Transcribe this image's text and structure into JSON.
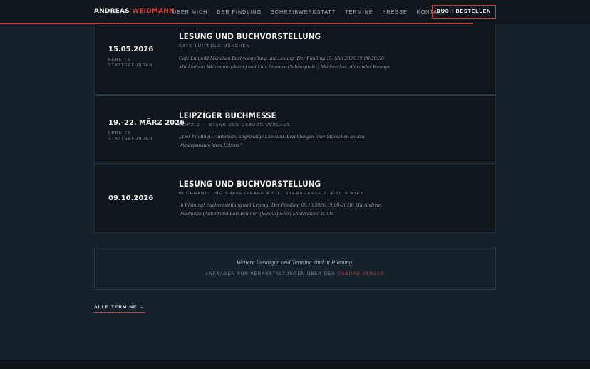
{
  "header": {
    "logo_first": "ANDREAS ",
    "logo_second": "WEIDMANN",
    "nav": [
      "ÜBER MICH",
      "DER FINDLING",
      "SCHREIBWERKSTATT",
      "TERMINE",
      "PRESSE",
      "KONTAKT"
    ],
    "order_button": "BUCH BESTELLEN"
  },
  "events": [
    {
      "date": "15.05.2026",
      "status": "BEREITS STATTGEFUNDEN",
      "title": "LESUNG UND BUCHVORSTELLUNG",
      "venue": "CAFE LUITPOLD MÜNCHEN",
      "description": "Cafe Luitpold München Buchvorstellung und Lesung: Der Findling 15. Mai 2026 19:00-20:30 Mit Andreas Weidmann (Autor) und Luis Brunner (Schauspieler) Moderation: Alexander Krampe"
    },
    {
      "date": "19.-22. MÄRZ 2026",
      "status": "BEREITS STATTGEFUNDEN",
      "title": "LEIPZIGER BUCHMESSE",
      "venue": "LEIPZIG — STAND DES OSBURG VERLAGS",
      "description": "„Der Findling. Funkelnde, abgründige Literatur. Erzählungen über Menschen an den Wendepunkten ihres Lebens.\""
    },
    {
      "date": "09.10.2026",
      "status": "",
      "title": "LESUNG UND BUCHVORSTELLUNG",
      "venue": "BUCHHANDLUNG SHAKESPEARE & CO., STERNGASSE 2, A-1010 WIEN",
      "description": "In Planung! Buchvorstellung und Lesung: Der Findling 09.10.2026 19:00-20:30 Mit Andreas Weidmann (Autor) und Luis Brunner (Schauspieler) Moderation: n.n.b."
    }
  ],
  "more": {
    "text": "Weitere Lesungen und Termine sind in Planung.",
    "sub_prefix": "ANFRAGEN FÜR VERANSTALTUNGEN ÜBER DEN ",
    "sub_link": "OSBURG VERLAG"
  },
  "all_dates_link": "ALLE TERMINE →",
  "colors": {
    "accent": "#c2413c",
    "background": "#15212b",
    "card": "#0f161c"
  }
}
